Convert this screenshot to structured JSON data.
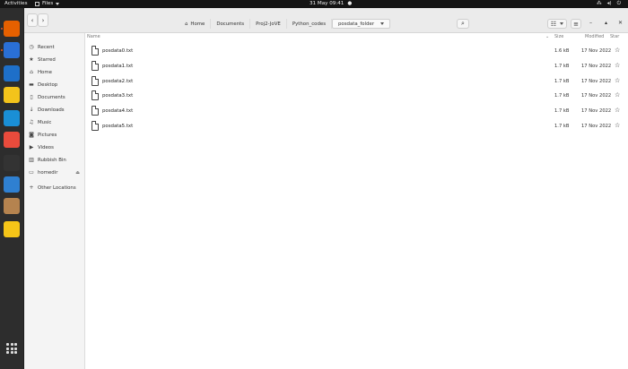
{
  "topbar": {
    "activities": "Activities",
    "app_name": "Files",
    "clock": "31 May  09:41",
    "clock_dot": "●"
  },
  "dock": {
    "apps": [
      {
        "name": "firefox",
        "color": "#e66000"
      },
      {
        "name": "thunderbird",
        "color": "#2a6fd6"
      },
      {
        "name": "libreoffice-writer",
        "color": "#1e6fc9"
      },
      {
        "name": "rhythmbox",
        "color": "#f3c31b"
      },
      {
        "name": "libreoffice-impress",
        "color": "#1a8fd6"
      },
      {
        "name": "help",
        "color": "#e94b3c"
      },
      {
        "name": "terminal",
        "color": "#333333"
      },
      {
        "name": "vscode",
        "color": "#2f80d1"
      },
      {
        "name": "archive",
        "color": "#b5834f"
      },
      {
        "name": "text-editor",
        "color": "#f5c518"
      }
    ],
    "show_apps": "show-apps"
  },
  "headerbar": {
    "back_glyph": "‹",
    "forward_glyph": "›",
    "crumbs": [
      "Home",
      "Documents",
      "Proj2-JoVE",
      "Python_codes",
      "posdata_folder"
    ],
    "search_icon": "⌕",
    "view_icon": "☷",
    "menu_icon": "≡",
    "min": "–",
    "max": "▴",
    "close": "✕"
  },
  "sidebar": {
    "items": [
      {
        "label": "Recent",
        "icon": "◷"
      },
      {
        "label": "Starred",
        "icon": "★"
      },
      {
        "label": "Home",
        "icon": "⌂"
      },
      {
        "label": "Desktop",
        "icon": "▬"
      },
      {
        "label": "Documents",
        "icon": "▯"
      },
      {
        "label": "Downloads",
        "icon": "↓"
      },
      {
        "label": "Music",
        "icon": "♫"
      },
      {
        "label": "Pictures",
        "icon": "◙"
      },
      {
        "label": "Videos",
        "icon": "▶"
      },
      {
        "label": "Rubbish Bin",
        "icon": "▥"
      },
      {
        "label": "homedir",
        "icon": "▭",
        "eject": "⏏"
      },
      {
        "label": "Other Locations",
        "icon": "+"
      }
    ]
  },
  "table": {
    "headers": {
      "name": "Name",
      "size": "Size",
      "modified": "Modified",
      "star": "Star"
    },
    "files": [
      {
        "name": "posdata0.txt",
        "size": "1.6 kB",
        "modified": "17 Nov 2022"
      },
      {
        "name": "posdata1.txt",
        "size": "1.7 kB",
        "modified": "17 Nov 2022"
      },
      {
        "name": "posdata2.txt",
        "size": "1.7 kB",
        "modified": "17 Nov 2022"
      },
      {
        "name": "posdata3.txt",
        "size": "1.7 kB",
        "modified": "17 Nov 2022"
      },
      {
        "name": "posdata4.txt",
        "size": "1.7 kB",
        "modified": "17 Nov 2022"
      },
      {
        "name": "posdata5.txt",
        "size": "1.7 kB",
        "modified": "17 Nov 2022"
      }
    ],
    "star_glyph": "☆"
  }
}
